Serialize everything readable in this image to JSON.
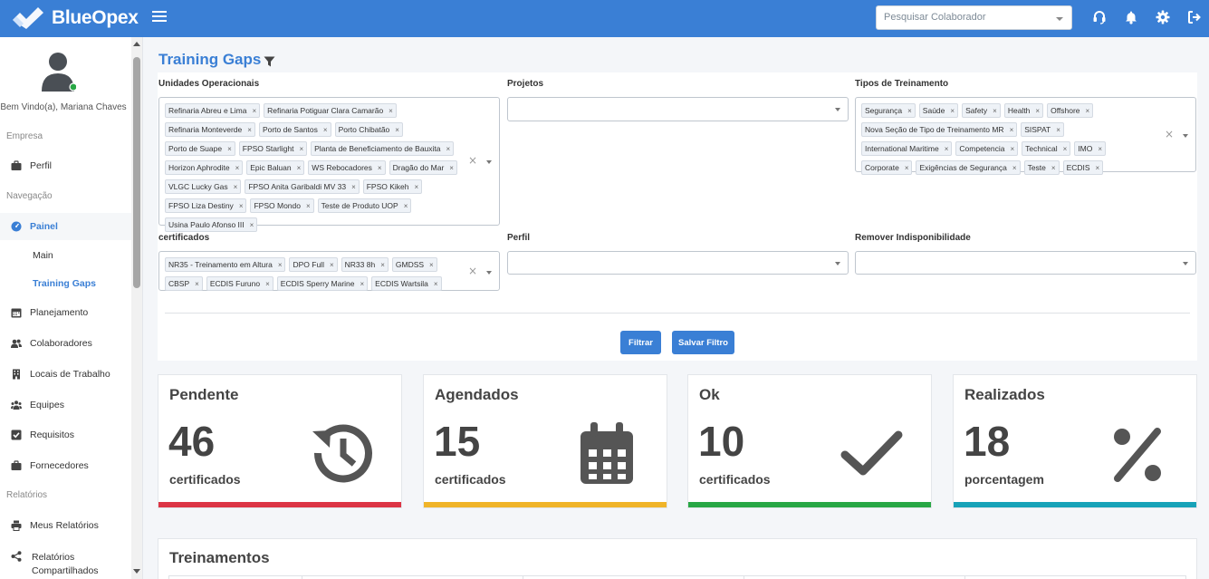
{
  "app": {
    "name": "BlueOpex"
  },
  "header": {
    "search_placeholder": "Pesquisar Colaborador"
  },
  "user": {
    "welcome": "Bem Vindo(a), Mariana Chaves"
  },
  "sidebar": {
    "sections": {
      "empresa": "Empresa",
      "navegacao": "Navegação",
      "relatorios": "Relatórios"
    },
    "perfil": "Perfil",
    "painel": "Painel",
    "painel_sub": [
      "Main",
      "Training Gaps"
    ],
    "items": [
      "Planejamento",
      "Colaboradores",
      "Locais de Trabalho",
      "Equipes",
      "Requisitos",
      "Fornecedores"
    ],
    "reports": [
      "Meus Relatórios",
      "Relatórios Compartilhados"
    ]
  },
  "page": {
    "title": "Training Gaps"
  },
  "filters": {
    "unidades": {
      "label": "Unidades Operacionais",
      "values": [
        "Refinaria Abreu e Lima",
        "Refinaria Potiguar Clara Camarão",
        "Refinaria Monteverde",
        "Porto de Santos",
        "Porto Chibatão",
        "Porto de Suape",
        "FPSO Starlight",
        "Planta de Beneficiamento de Bauxita",
        "Horizon Aphrodite",
        "Epic Baluan",
        "WS Rebocadores",
        "Dragão do Mar",
        "VLGC Lucky Gas",
        "FPSO Anita Garibaldi MV 33",
        "FPSO Kikeh",
        "FPSO Liza Destiny",
        "FPSO Mondo",
        "Teste de Produto UOP",
        "Usina Paulo Afonso III"
      ]
    },
    "projetos": {
      "label": "Projetos",
      "values": []
    },
    "tipos": {
      "label": "Tipos de Treinamento",
      "values": [
        "Segurança",
        "Saúde",
        "Safety",
        "Health",
        "Offshore",
        "Nova Seção de Tipo de Treinamento MR",
        "SISPAT",
        "International Maritime",
        "Competencia",
        "Technical",
        "IMO",
        "Corporate",
        "Exigências de Segurança",
        "Teste",
        "ECDIS"
      ]
    },
    "certificados": {
      "label": "certificados",
      "values": [
        "NR35 - Treinamento em Altura",
        "DPO Full",
        "NR33 8h",
        "GMDSS",
        "CBSP",
        "ECDIS Furuno",
        "ECDIS Sperry Marine",
        "ECDIS Wartsila"
      ]
    },
    "perfil": {
      "label": "Perfil",
      "values": []
    },
    "remover": {
      "label": "Remover Indisponibilidade",
      "values": []
    },
    "chip_remove": "×",
    "clear_all": "×"
  },
  "buttons": {
    "filtrar": "Filtrar",
    "salvar": "Salvar Filtro"
  },
  "cards": [
    {
      "title": "Pendente",
      "value": "46",
      "sub": "certificados",
      "icon": "history-icon",
      "color": "#dc3545"
    },
    {
      "title": "Agendados",
      "value": "15",
      "sub": "certificados",
      "icon": "calendar-icon",
      "color": "#f0b429"
    },
    {
      "title": "Ok",
      "value": "10",
      "sub": "certificados",
      "icon": "check-icon",
      "color": "#28a745"
    },
    {
      "title": "Realizados",
      "value": "18",
      "sub": "porcentagem",
      "icon": "percent-icon",
      "color": "#17a2b8"
    }
  ],
  "trainings": {
    "title": "Treinamentos"
  }
}
